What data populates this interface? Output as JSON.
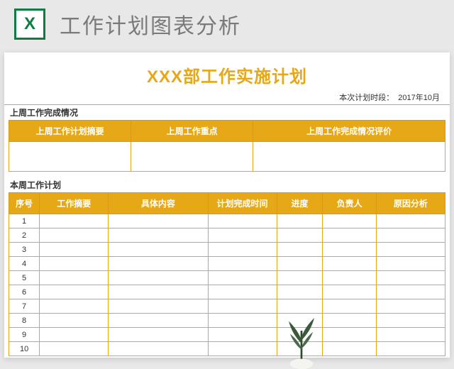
{
  "topbar": {
    "title": "工作计划图表分析",
    "icon_letter": "X"
  },
  "sheet": {
    "main_title": "XXX部工作实施计划",
    "period_label": "本次计划时段：",
    "period_value": "2017年10月"
  },
  "upper": {
    "section_label": "上周工作完成情况",
    "headers": {
      "c1": "上周工作计划摘要",
      "c2": "上周工作重点",
      "c3": "上周工作完成情况评价"
    },
    "rows": [
      {
        "c1": "",
        "c2": "",
        "c3": ""
      }
    ]
  },
  "lower": {
    "section_label": "本周工作计划",
    "headers": {
      "num": "序号",
      "summary": "工作摘要",
      "detail": "具体内容",
      "time": "计划完成时间",
      "progress": "进度",
      "owner": "负责人",
      "reason": "原因分析"
    },
    "rows": [
      {
        "num": "1",
        "summary": "",
        "detail": "",
        "time": "",
        "progress": "",
        "owner": "",
        "reason": ""
      },
      {
        "num": "2",
        "summary": "",
        "detail": "",
        "time": "",
        "progress": "",
        "owner": "",
        "reason": ""
      },
      {
        "num": "3",
        "summary": "",
        "detail": "",
        "time": "",
        "progress": "",
        "owner": "",
        "reason": ""
      },
      {
        "num": "4",
        "summary": "",
        "detail": "",
        "time": "",
        "progress": "",
        "owner": "",
        "reason": ""
      },
      {
        "num": "5",
        "summary": "",
        "detail": "",
        "time": "",
        "progress": "",
        "owner": "",
        "reason": ""
      },
      {
        "num": "6",
        "summary": "",
        "detail": "",
        "time": "",
        "progress": "",
        "owner": "",
        "reason": ""
      },
      {
        "num": "7",
        "summary": "",
        "detail": "",
        "time": "",
        "progress": "",
        "owner": "",
        "reason": ""
      },
      {
        "num": "8",
        "summary": "",
        "detail": "",
        "time": "",
        "progress": "",
        "owner": "",
        "reason": ""
      },
      {
        "num": "9",
        "summary": "",
        "detail": "",
        "time": "",
        "progress": "",
        "owner": "",
        "reason": ""
      },
      {
        "num": "10",
        "summary": "",
        "detail": "",
        "time": "",
        "progress": "",
        "owner": "",
        "reason": ""
      }
    ]
  }
}
